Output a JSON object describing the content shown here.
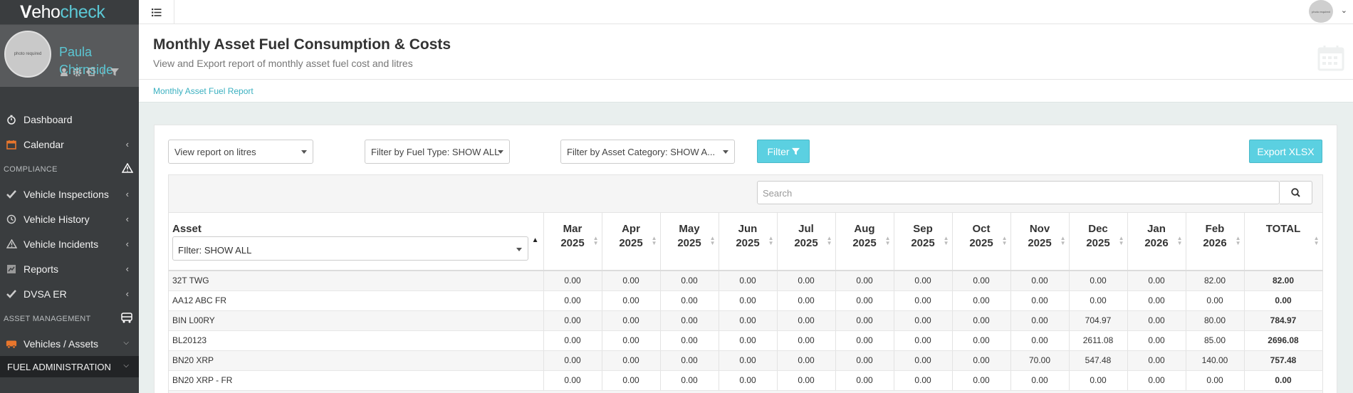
{
  "app": {
    "logo": {
      "v": "V",
      "eho": "eho",
      "check": "check"
    },
    "user": {
      "first": "Paula",
      "last": "Chirnside",
      "avatar_text": "photo required"
    },
    "top_avatar_text": "photo required"
  },
  "nav": {
    "dashboard": "Dashboard",
    "calendar": "Calendar",
    "section_compliance": "COMPLIANCE",
    "vehicle_inspections": "Vehicle Inspections",
    "vehicle_history": "Vehicle History",
    "vehicle_incidents": "Vehicle Incidents",
    "reports": "Reports",
    "dvsa_er": "DVSA ER",
    "section_asset": "ASSET MANAGEMENT",
    "vehicles_assets": "Vehicles / Assets",
    "fuel_admin": "FUEL ADMINISTRATION"
  },
  "header": {
    "title": "Monthly Asset Fuel Consumption & Costs",
    "subtitle": "View and Export report of monthly asset fuel cost and litres",
    "breadcrumb": "Monthly Asset Fuel Report"
  },
  "filters": {
    "view": "View report on litres",
    "fuel_type": "Filter by Fuel Type: SHOW ALL",
    "asset_category": "Filter by Asset Category: SHOW A...",
    "filter_btn": "Filter",
    "export_btn": "Export XLSX",
    "search_placeholder": "Search"
  },
  "table": {
    "asset_header": "Asset",
    "asset_filter": "FIlter: SHOW ALL",
    "months": [
      {
        "m": "Mar",
        "y": "2025"
      },
      {
        "m": "Apr",
        "y": "2025"
      },
      {
        "m": "May",
        "y": "2025"
      },
      {
        "m": "Jun",
        "y": "2025"
      },
      {
        "m": "Jul",
        "y": "2025"
      },
      {
        "m": "Aug",
        "y": "2025"
      },
      {
        "m": "Sep",
        "y": "2025"
      },
      {
        "m": "Oct",
        "y": "2025"
      },
      {
        "m": "Nov",
        "y": "2025"
      },
      {
        "m": "Dec",
        "y": "2025"
      },
      {
        "m": "Jan",
        "y": "2026"
      },
      {
        "m": "Feb",
        "y": "2026"
      }
    ],
    "total_header": "TOTAL",
    "rows": [
      {
        "asset": "32T TWG",
        "values": [
          "0.00",
          "0.00",
          "0.00",
          "0.00",
          "0.00",
          "0.00",
          "0.00",
          "0.00",
          "0.00",
          "0.00",
          "0.00",
          "82.00"
        ],
        "total": "82.00"
      },
      {
        "asset": "AA12 ABC FR",
        "values": [
          "0.00",
          "0.00",
          "0.00",
          "0.00",
          "0.00",
          "0.00",
          "0.00",
          "0.00",
          "0.00",
          "0.00",
          "0.00",
          "0.00"
        ],
        "total": "0.00"
      },
      {
        "asset": "BIN L00RY",
        "values": [
          "0.00",
          "0.00",
          "0.00",
          "0.00",
          "0.00",
          "0.00",
          "0.00",
          "0.00",
          "0.00",
          "704.97",
          "0.00",
          "80.00"
        ],
        "total": "784.97"
      },
      {
        "asset": "BL20123",
        "values": [
          "0.00",
          "0.00",
          "0.00",
          "0.00",
          "0.00",
          "0.00",
          "0.00",
          "0.00",
          "0.00",
          "2611.08",
          "0.00",
          "85.00"
        ],
        "total": "2696.08"
      },
      {
        "asset": "BN20 XRP",
        "values": [
          "0.00",
          "0.00",
          "0.00",
          "0.00",
          "0.00",
          "0.00",
          "0.00",
          "0.00",
          "70.00",
          "547.48",
          "0.00",
          "140.00"
        ],
        "total": "757.48"
      },
      {
        "asset": "BN20 XRP - FR",
        "values": [
          "0.00",
          "0.00",
          "0.00",
          "0.00",
          "0.00",
          "0.00",
          "0.00",
          "0.00",
          "0.00",
          "0.00",
          "0.00",
          "0.00"
        ],
        "total": "0.00"
      }
    ]
  },
  "colors": {
    "accent": "#5bd0e1",
    "sidebar_bg": "#3a3d3f",
    "orange_icon": "#e8762c"
  }
}
